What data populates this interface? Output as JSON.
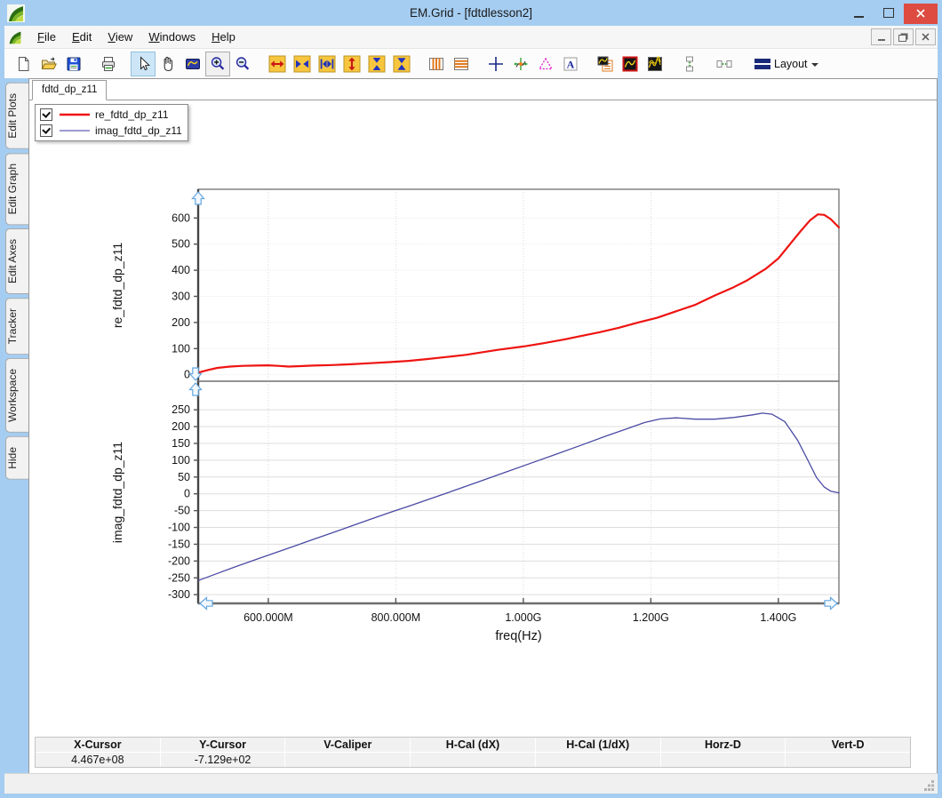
{
  "window": {
    "title": "EM.Grid - [fdtdlesson2]"
  },
  "menu": {
    "items": [
      {
        "label": "File"
      },
      {
        "label": "Edit"
      },
      {
        "label": "View"
      },
      {
        "label": "Windows"
      },
      {
        "label": "Help"
      }
    ]
  },
  "toolbar": {
    "layout_label": "Layout",
    "a_glyph": "A",
    "icons": [
      "new-document",
      "open-file",
      "save",
      "print",
      "select-arrow",
      "pan-hand",
      "zoom-window",
      "zoom-in",
      "zoom-out",
      "expand-x-red",
      "arrows-x-blue",
      "fit-x-margins",
      "expand-y-red",
      "arrows-y-blue",
      "fit-y-compress",
      "vertical-stripes",
      "horizontal-stripes",
      "cross-cursor",
      "axes-marker",
      "triangle-marker",
      "text-label",
      "show-legend",
      "single-plot",
      "multi-plot",
      "vertical-spacing",
      "horizontal-spacing",
      "layout-dropdown"
    ]
  },
  "sidebar": {
    "tabs": [
      "Edit Plots",
      "Edit Graph",
      "Edit Axes",
      "Tracker",
      "Workspace",
      "Hide"
    ]
  },
  "document": {
    "tab": "fdtd_dp_z11"
  },
  "legend": {
    "items": [
      {
        "label": "re_fdtd_dp_z11",
        "color": "#ee1411",
        "checked": true
      },
      {
        "label": "imag_fdtd_dp_z11",
        "color": "#7a7ac0",
        "checked": true
      }
    ]
  },
  "chart_data": [
    {
      "type": "line",
      "title": "",
      "ylabel": "re_fdtd_dp_z11",
      "xlabel": "",
      "x_unit": "GHz",
      "xlim": [
        0.49,
        1.495
      ],
      "ylim": [
        -25,
        710
      ],
      "xticks": [
        0.6,
        0.8,
        1.0,
        1.2,
        1.4
      ],
      "xtick_labels": [
        "600.000M",
        "800.000M",
        "1.000G",
        "1.200G",
        "1.400G"
      ],
      "yticks": [
        0,
        100,
        200,
        300,
        400,
        500,
        600
      ],
      "grid": true,
      "series": [
        {
          "name": "re_fdtd_dp_z11",
          "color": "#ee1411",
          "width": 2.2,
          "x": [
            0.49,
            0.505,
            0.52,
            0.54,
            0.56,
            0.58,
            0.6,
            0.615,
            0.632,
            0.65,
            0.67,
            0.7,
            0.73,
            0.76,
            0.79,
            0.82,
            0.85,
            0.88,
            0.91,
            0.933,
            0.96,
            1.0,
            1.03,
            1.06,
            1.09,
            1.12,
            1.15,
            1.18,
            1.21,
            1.24,
            1.27,
            1.3,
            1.33,
            1.35,
            1.38,
            1.4,
            1.42,
            1.435,
            1.45,
            1.462,
            1.472,
            1.482,
            1.495
          ],
          "y": [
            8,
            18,
            26,
            31,
            34,
            35,
            36,
            34,
            31,
            33,
            35,
            37,
            40,
            44,
            48,
            53,
            60,
            68,
            76,
            85,
            95,
            108,
            120,
            133,
            148,
            163,
            180,
            200,
            218,
            243,
            268,
            303,
            335,
            360,
            405,
            445,
            505,
            550,
            592,
            614,
            612,
            596,
            564
          ]
        }
      ]
    },
    {
      "type": "line",
      "title": "",
      "ylabel": "imag_fdtd_dp_z11",
      "xlabel": "freq(Hz)",
      "x_unit": "GHz",
      "xlim": [
        0.49,
        1.495
      ],
      "ylim": [
        -326,
        335
      ],
      "xticks": [
        0.6,
        0.8,
        1.0,
        1.2,
        1.4
      ],
      "xtick_labels": [
        "600.000M",
        "800.000M",
        "1.000G",
        "1.200G",
        "1.400G"
      ],
      "yticks": [
        -300,
        -250,
        -200,
        -150,
        -100,
        -50,
        0,
        50,
        100,
        150,
        200,
        250
      ],
      "grid": true,
      "series": [
        {
          "name": "imag_fdtd_dp_z11",
          "color": "#4a4aa4",
          "width": 1.3,
          "x": [
            0.49,
            0.52,
            0.55,
            0.58,
            0.61,
            0.64,
            0.67,
            0.7,
            0.73,
            0.76,
            0.79,
            0.82,
            0.855,
            0.89,
            0.93,
            0.97,
            1.01,
            1.05,
            1.09,
            1.13,
            1.16,
            1.19,
            1.215,
            1.24,
            1.27,
            1.3,
            1.33,
            1.36,
            1.375,
            1.39,
            1.41,
            1.43,
            1.445,
            1.46,
            1.472,
            1.482,
            1.495
          ],
          "y": [
            -258,
            -237,
            -216,
            -196,
            -176,
            -156,
            -136,
            -116,
            -96,
            -76,
            -56,
            -37,
            -14,
            9,
            36,
            63,
            90,
            117,
            144,
            172,
            192,
            212,
            223,
            226,
            222,
            222,
            227,
            235,
            240,
            237,
            215,
            160,
            105,
            48,
            20,
            8,
            3
          ]
        }
      ]
    }
  ],
  "status_bar": {
    "columns": [
      {
        "label": "X-Cursor",
        "value": "4.467e+08"
      },
      {
        "label": "Y-Cursor",
        "value": "-7.129e+02"
      },
      {
        "label": "V-Caliper",
        "value": ""
      },
      {
        "label": "H-Cal (dX)",
        "value": ""
      },
      {
        "label": "H-Cal (1/dX)",
        "value": ""
      },
      {
        "label": "Horz-D",
        "value": ""
      },
      {
        "label": "Vert-D",
        "value": ""
      }
    ]
  }
}
